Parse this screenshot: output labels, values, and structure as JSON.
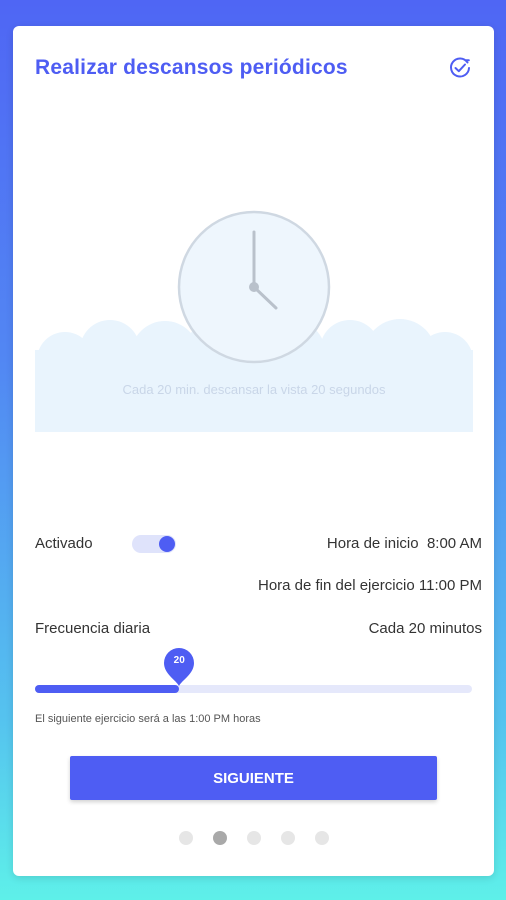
{
  "header": {
    "title": "Realizar descansos periódicos",
    "done_icon": "check-circle-icon"
  },
  "illustration": {
    "icon": "clock-icon",
    "caption": "Cada 20 min. descansar la vista 20 segundos"
  },
  "settings": {
    "activated_label": "Activado",
    "activated_on": true,
    "start_label": "Hora de inicio",
    "start_value": "8:00 AM",
    "end_label": "Hora de fin del ejercicio",
    "end_value": "11:00 PM",
    "frequency_label": "Frecuencia diaria",
    "frequency_value": "Cada 20 minutos"
  },
  "slider": {
    "value": "20",
    "fraction": 0.33
  },
  "next_note": "El siguiente ejercicio será a las 1:00 PM horas",
  "button": {
    "label": "SIGUIENTE"
  },
  "pagination": {
    "count": 5,
    "active_index": 1
  },
  "colors": {
    "accent": "#4e5df3",
    "track": "#e5e8fb",
    "background_top": "#4f66f4",
    "background_bottom": "#5ef0e9"
  }
}
